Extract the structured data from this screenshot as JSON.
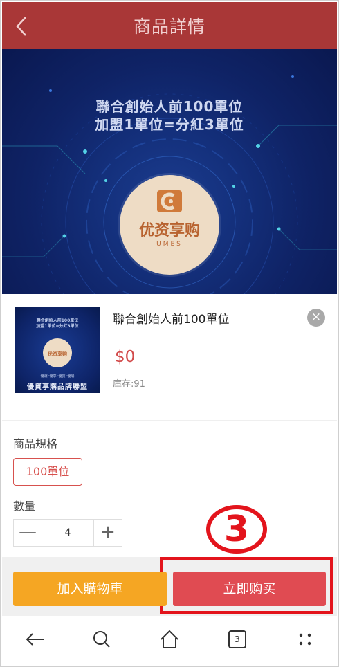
{
  "header": {
    "title": "商品詳情",
    "back_icon": "chevron-left-icon"
  },
  "banner": {
    "line1": "聯合創始人前100單位",
    "line2": "加盟1單位=分紅3單位",
    "brand": "优资享购",
    "brand_sub": "UMES"
  },
  "product": {
    "title": "聯合創始人前100單位",
    "price": "$0",
    "stock": "庫存:91",
    "thumb_line1": "聯合創始人前100單位",
    "thumb_line2": "加盟1單位=分紅3單位",
    "thumb_brand": "优资享购",
    "thumb_tagline": "優選•優享•優質•優購",
    "thumb_footer": "優資享購品牌聯盟"
  },
  "spec": {
    "label": "商品規格",
    "selected": "100單位"
  },
  "quantity": {
    "label": "數量",
    "minus": "—",
    "value": "4",
    "plus": "+"
  },
  "annotation": {
    "step": "3"
  },
  "actions": {
    "add_to_cart": "加入購物車",
    "buy_now": "立即购买"
  },
  "nav": {
    "tabs_count": "3"
  },
  "colors": {
    "header_bg": "#a93737",
    "price": "#d24a4a",
    "cart_btn": "#f5a623",
    "buy_btn": "#e04b52",
    "highlight": "#e3141c"
  }
}
